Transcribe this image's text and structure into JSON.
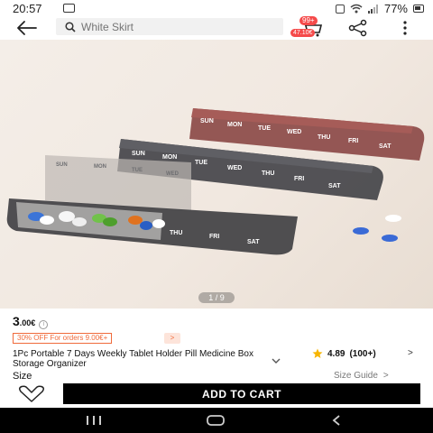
{
  "status_bar": {
    "time": "20:57",
    "battery": "77%"
  },
  "header": {
    "search_placeholder": "White Skirt",
    "cart_badge": "99+",
    "cart_total": "47.10€"
  },
  "gallery": {
    "page_indicator": "1 / 9",
    "organizer_labels_front": [
      "SUN",
      "MON",
      "TUE",
      "WED",
      "THU",
      "FRI",
      "SAT"
    ],
    "organizer_labels_back": [
      "SUN",
      "MON",
      "TUE",
      "WED",
      "THU",
      "FRI",
      "SAT"
    ],
    "organizer_labels_open": [
      "THU",
      "FRI",
      "SAT"
    ],
    "open_lid_labels": [
      "SUN",
      "MON",
      "TUE",
      "WED"
    ]
  },
  "product": {
    "price_main": "3",
    "price_suffix": ".00€",
    "promo": "30% OFF For orders 9.00€+",
    "promo_arrow": ">",
    "title": "1Pc Portable 7 Days Weekly Tablet Holder Pill Medicine Box Storage Organizer",
    "rating": "4.89",
    "rating_count": "(100+)",
    "rating_arrow": ">",
    "size_label": "Size",
    "size_guide": "Size Guide",
    "size_guide_arrow": ">"
  },
  "actions": {
    "add_to_cart": "ADD TO CART"
  },
  "colors": {
    "accent": "#f06a3b",
    "badge": "#f54a4a",
    "star": "#f7b500",
    "button": "#000000"
  }
}
